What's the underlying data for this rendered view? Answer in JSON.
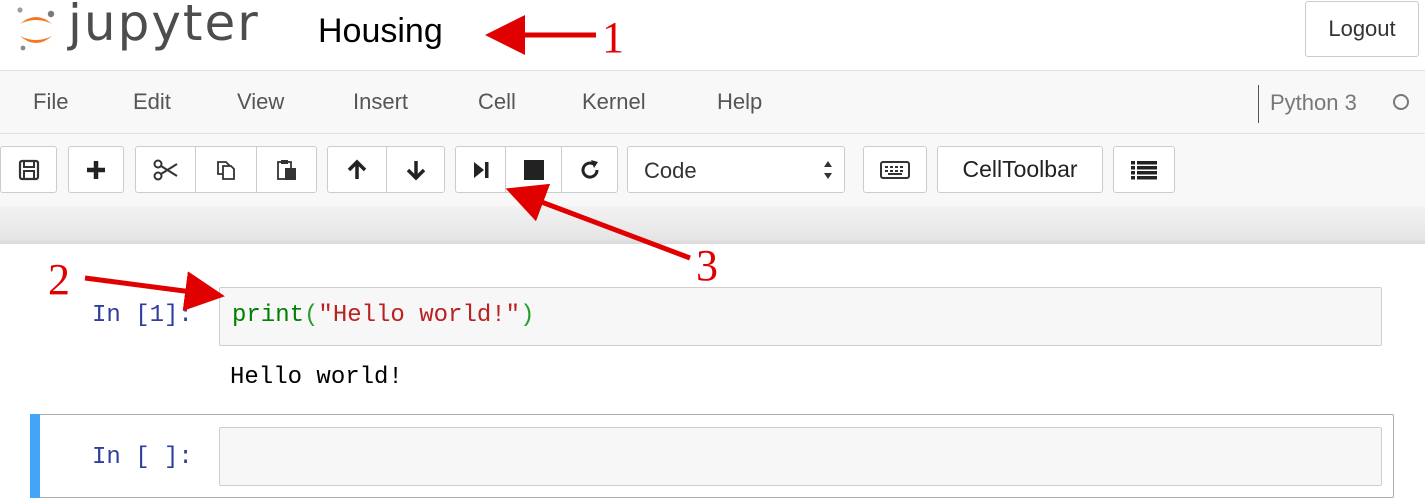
{
  "header": {
    "logo_text": "jupyter",
    "notebook_title": "Housing",
    "logout_label": "Logout"
  },
  "menubar": {
    "items": [
      "File",
      "Edit",
      "View",
      "Insert",
      "Cell",
      "Kernel",
      "Help"
    ],
    "kernel_name": "Python 3"
  },
  "toolbar": {
    "buttons": [
      "save-icon",
      "plus-icon",
      "cut-icon",
      "copy-icon",
      "paste-icon",
      "arrow-up-icon",
      "arrow-down-icon",
      "run-next-icon",
      "stop-icon",
      "restart-icon"
    ],
    "cell_type": "Code",
    "celltoolbar_label": "CellToolbar"
  },
  "cells": [
    {
      "prompt": "In [1]:",
      "code": {
        "builtin": "print",
        "open": "(",
        "string": "\"Hello world!\"",
        "close": ")"
      },
      "output": "Hello world!"
    },
    {
      "prompt": "In [ ]:",
      "code": ""
    }
  ],
  "annotations": [
    "1",
    "2",
    "3"
  ],
  "colors": {
    "accent_selected_cell": "#42A5F5",
    "prompt": "#303F9F",
    "annotation": "#E00000",
    "logo_orange": "#F37726"
  }
}
